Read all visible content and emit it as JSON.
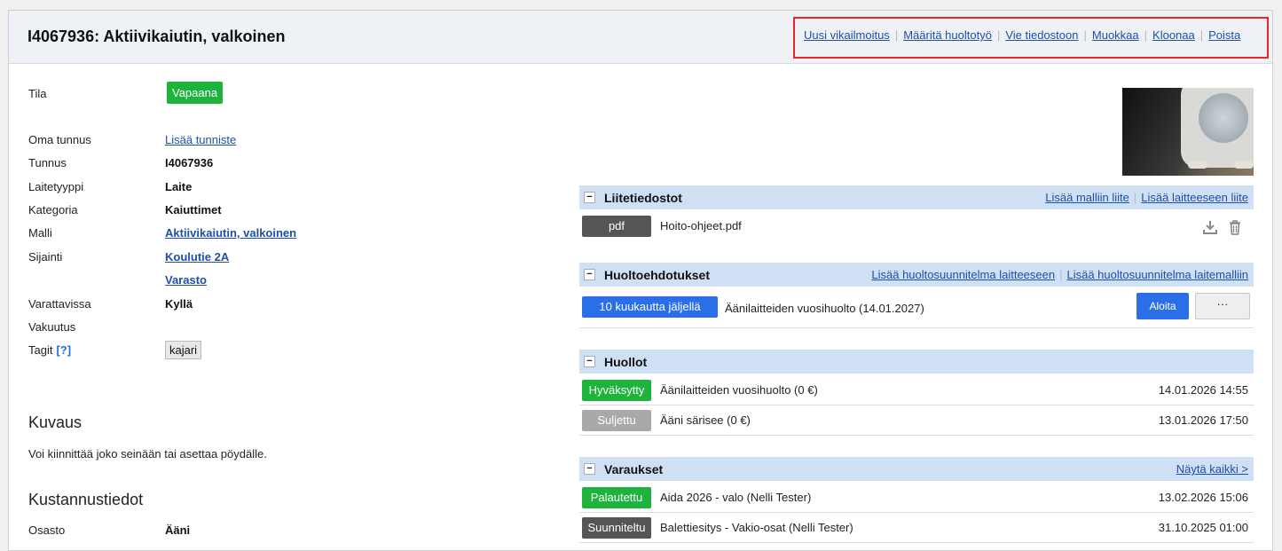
{
  "header": {
    "title": "I4067936: Aktiivikaiutin, valkoinen",
    "actions": [
      "Uusi vikailmoitus",
      "Määritä huoltotyö",
      "Vie tiedostoon",
      "Muokkaa",
      "Kloonaa",
      "Poista"
    ]
  },
  "details": {
    "tila_label": "Tila",
    "tila_value": "Vapaana",
    "oma_tunnus_label": "Oma tunnus",
    "oma_tunnus_link": "Lisää tunniste",
    "tunnus_label": "Tunnus",
    "tunnus_value": "I4067936",
    "laitetyyppi_label": "Laitetyyppi",
    "laitetyyppi_value": "Laite",
    "kategoria_label": "Kategoria",
    "kategoria_value": "Kaiuttimet",
    "malli_label": "Malli",
    "malli_value": "Aktiivikaiutin, valkoinen",
    "sijainti_label": "Sijainti",
    "sijainti_value_1": "Koulutie 2A",
    "sijainti_value_2": "Varasto",
    "varattavissa_label": "Varattavissa",
    "varattavissa_value": "Kyllä",
    "vakuutus_label": "Vakuutus",
    "tagit_label": "Tagit",
    "tagit_help": "[?]",
    "tag": "kajari"
  },
  "description": {
    "heading": "Kuvaus",
    "text": "Voi kiinnittää joko seinään tai asettaa pöydälle."
  },
  "costs": {
    "heading": "Kustannustiedot",
    "osasto_label": "Osasto",
    "osasto_value": "Ääni"
  },
  "attachments": {
    "title": "Liitetiedostot",
    "links": [
      "Lisää malliin liite",
      "Lisää laitteeseen liite"
    ],
    "file_type": "pdf",
    "file_name": "Hoito-ohjeet.pdf"
  },
  "maintenance_plans": {
    "title": "Huoltoehdotukset",
    "links": [
      "Lisää huoltosuunnitelma laitteeseen",
      "Lisää huoltosuunnitelma laitemalliin"
    ],
    "badge": "10 kuukautta jäljellä",
    "text": "Äänilaitteiden vuosihuolto (14.01.2027)",
    "start_button": "Aloita",
    "more_button": "···"
  },
  "services": {
    "title": "Huollot",
    "rows": [
      {
        "status": "Hyväksytty",
        "text": "Äänilaitteiden vuosihuolto (0 €)",
        "date": "14.01.2026 14:55",
        "color": "#1db33c"
      },
      {
        "status": "Suljettu",
        "text": "Ääni särisee (0 €)",
        "date": "13.01.2026 17:50",
        "color": "#a9a9a9"
      }
    ]
  },
  "reservations": {
    "title": "Varaukset",
    "show_all": "Näytä kaikki >",
    "rows": [
      {
        "status": "Palautettu",
        "text": "Aida 2026 - valo (Nelli Tester)",
        "date": "13.02.2026 15:06",
        "color": "#1db33c"
      },
      {
        "status": "Suunniteltu",
        "text": "Balettiesitys - Vakio-osat (Nelli Tester)",
        "date": "31.10.2025 01:00",
        "color": "#555555"
      }
    ]
  },
  "colors": {
    "accent": "#1f4fa6",
    "green": "#1db33c",
    "highlight": "#e8262b",
    "panel": "#cfe0f4"
  }
}
